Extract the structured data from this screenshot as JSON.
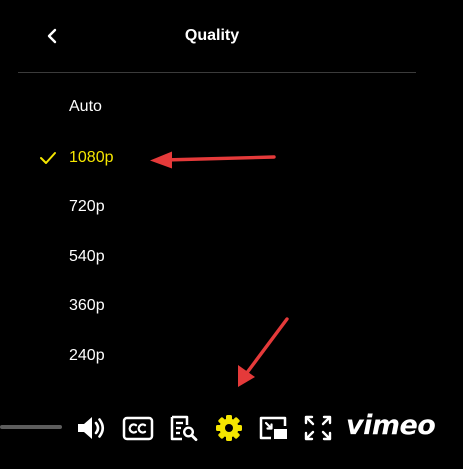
{
  "menu": {
    "title": "Quality",
    "back_icon": "chevron-left-icon",
    "options": [
      {
        "label": "Auto",
        "selected": false
      },
      {
        "label": "1080p",
        "selected": true
      },
      {
        "label": "720p",
        "selected": false
      },
      {
        "label": "540p",
        "selected": false
      },
      {
        "label": "360p",
        "selected": false
      },
      {
        "label": "240p",
        "selected": false
      }
    ],
    "selected_color": "#f5e600"
  },
  "controls": {
    "buttons": [
      {
        "name": "volume-button",
        "icon": "volume-icon"
      },
      {
        "name": "captions-button",
        "icon": "cc-icon"
      },
      {
        "name": "transcript-button",
        "icon": "transcript-search-icon"
      },
      {
        "name": "settings-button",
        "icon": "gear-icon",
        "active": true
      },
      {
        "name": "picture-in-picture-button",
        "icon": "pip-icon"
      },
      {
        "name": "fullscreen-button",
        "icon": "fullscreen-icon"
      }
    ],
    "brand": "vimeo",
    "active_color": "#f5e600"
  },
  "annotations": {
    "arrow_color": "#e53a3a"
  }
}
